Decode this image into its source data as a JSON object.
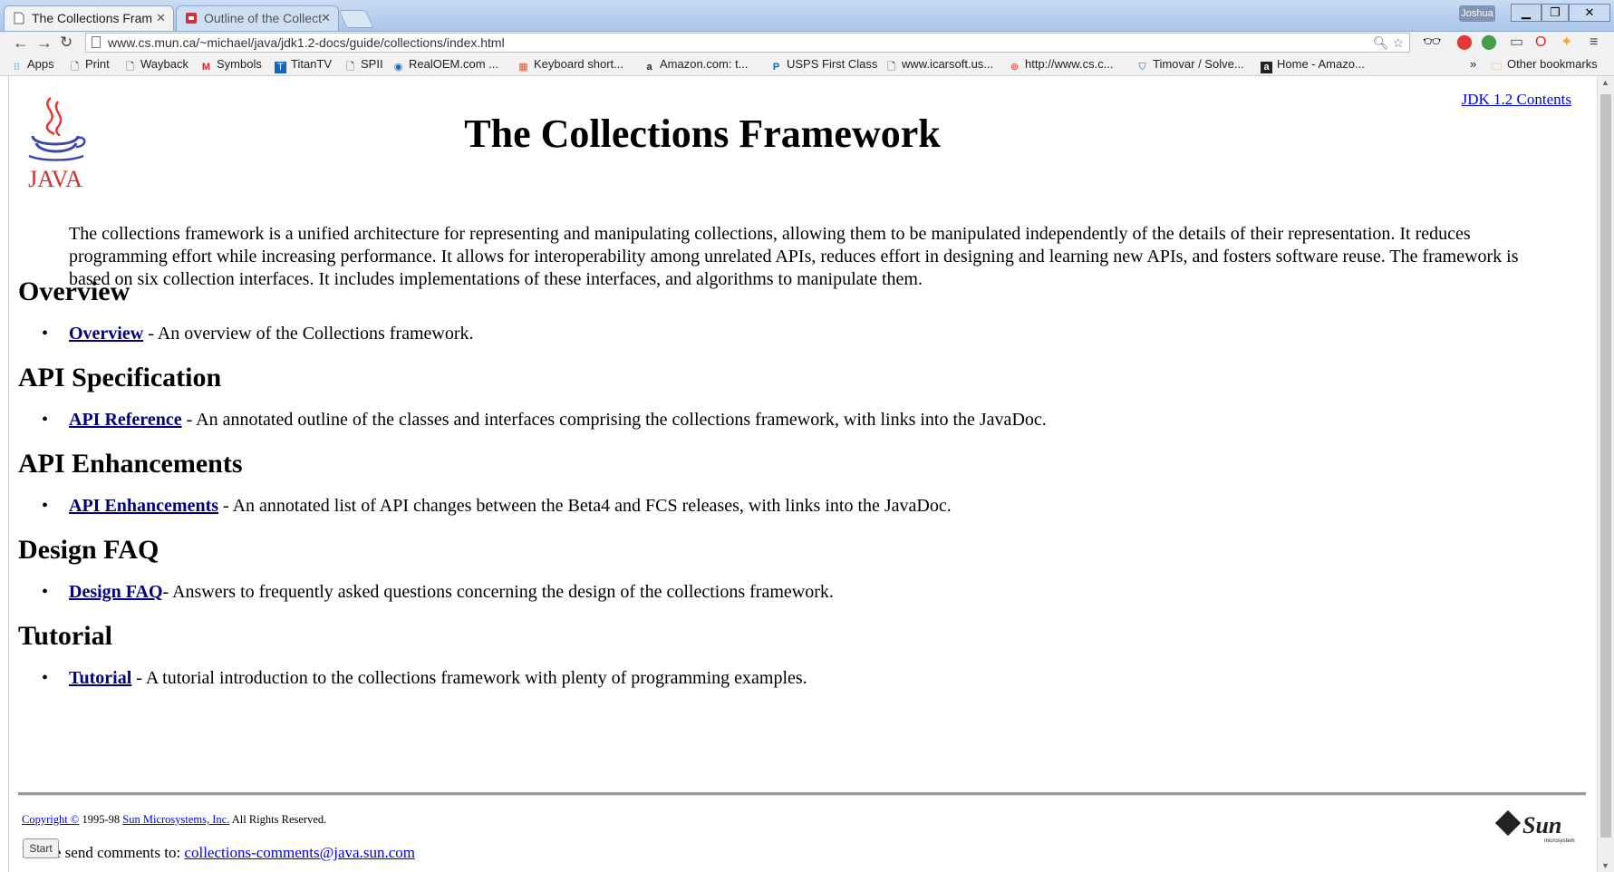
{
  "browser": {
    "tabs": [
      {
        "title": "The Collections Fram",
        "active": true
      },
      {
        "title": "Outline of the Collect",
        "active": false
      }
    ],
    "profile_name": "Joshua",
    "url": "www.cs.mun.ca/~michael/java/jdk1.2-docs/guide/collections/index.html",
    "bookmarks": [
      {
        "label": "Apps",
        "icon": "apps-grid-icon"
      },
      {
        "label": "Print",
        "icon": "page-icon"
      },
      {
        "label": "Wayback",
        "icon": "page-icon"
      },
      {
        "label": "Symbols",
        "icon": "gmail-icon"
      },
      {
        "label": "TitanTV",
        "icon": "titantv-icon"
      },
      {
        "label": "SPII",
        "icon": "page-icon"
      },
      {
        "label": "RealOEM.com ...",
        "icon": "bmw-icon"
      },
      {
        "label": "Keyboard short...",
        "icon": "windows-icon"
      },
      {
        "label": "Amazon.com: t...",
        "icon": "amazon-icon"
      },
      {
        "label": "USPS First Class",
        "icon": "paypal-icon"
      },
      {
        "label": "www.icarsoft.us...",
        "icon": "page-icon"
      },
      {
        "label": "http://www.cs.c...",
        "icon": "web-icon"
      },
      {
        "label": "Timovar / Solve...",
        "icon": "shield-icon"
      },
      {
        "label": "Home - Amazo...",
        "icon": "amazon-icon"
      }
    ],
    "overflow": "»",
    "other_bookmarks": "Other bookmarks"
  },
  "page": {
    "jdk_link": "JDK 1.2 Contents",
    "java_logo_text": "JAVA",
    "title": "The Collections Framework",
    "intro": "The collections framework is a unified architecture for representing and manipulating collections, allowing them to be manipulated independently of the details of their representation. It reduces programming effort while increasing performance. It allows for interoperability among unrelated APIs, reduces effort in designing and learning new APIs, and fosters software reuse. The framework is based on six collection interfaces. It includes implementations of these interfaces, and algorithms to manipulate them.",
    "sections": [
      {
        "heading": "Overview",
        "link": "Overview",
        "desc": " - An overview of the Collections framework."
      },
      {
        "heading": "API Specification",
        "link": "API Reference",
        "desc": " - An annotated outline of the classes and interfaces comprising the collections framework, with links into the JavaDoc."
      },
      {
        "heading": "API Enhancements",
        "link": "API Enhancements",
        "desc": " - An annotated list of API changes between the Beta4 and FCS releases, with links into the JavaDoc."
      },
      {
        "heading": "Design FAQ",
        "link": "Design FAQ",
        "desc": "- Answers to frequently asked questions concerning the design of the collections framework."
      },
      {
        "heading": "Tutorial",
        "link": "Tutorial",
        "desc": " - A tutorial introduction to the collections framework with plenty of programming examples."
      }
    ],
    "footer": {
      "copyright_link": "Copyright ©",
      "years": " 1995-98 ",
      "company_link": "Sun Microsystems, Inc.",
      "rights": " All Rights Reserved.",
      "comments_prefix": "Please send comments to: ",
      "comments_email": "collections-comments@java.sun.com"
    },
    "sun_logo_text": "Sun",
    "sun_logo_sub": "microsystems"
  },
  "overlay": {
    "start_button": "Start"
  },
  "colors": {
    "link": "#0000ee",
    "visited_link": "#000080"
  }
}
